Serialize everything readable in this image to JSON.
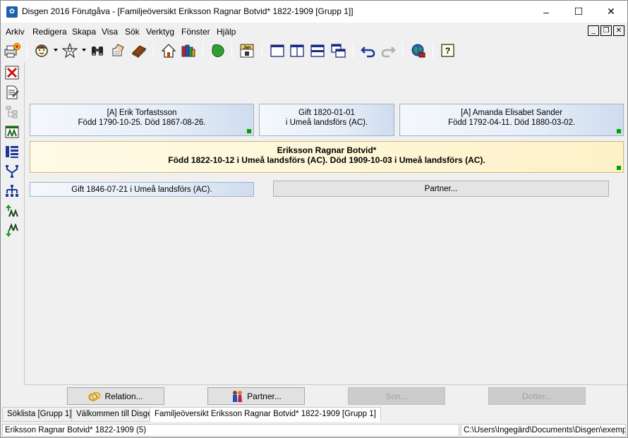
{
  "window": {
    "title": "Disgen 2016 Förutgåva - [Familjeöversikt Eriksson Ragnar Botvid* 1822-1909 [Grupp 1]]",
    "minimize": "–",
    "maximize": "☐",
    "close": "✕"
  },
  "menu": [
    "Arkiv",
    "Redigera",
    "Skapa",
    "Visa",
    "Sök",
    "Verktyg",
    "Fönster",
    "Hjälp"
  ],
  "mdi": {
    "minimize": "_",
    "restore": "❐",
    "close": "✕"
  },
  "toolbar_icons": [
    "print-icon",
    "person-icon",
    "star-person-icon",
    "binoculars-icon",
    "hand-icon",
    "book-icon",
    "home-icon",
    "books-icon",
    "map-icon",
    "calendar-icon",
    "window-single-icon",
    "window-split-icon",
    "window-horizontal-icon",
    "window-cascade-icon",
    "undo-icon",
    "redo-icon",
    "globe-icon",
    "help-icon"
  ],
  "calendar_label": "Jan",
  "help_label": "?",
  "family": {
    "father": {
      "name": "[A] Erik Torfastsson",
      "dates": "Född 1790-10-25. Död 1867-08-26."
    },
    "parents_marriage": {
      "line1": "Gift 1820-01-01",
      "line2": "i  Umeå landsförs (AC)."
    },
    "mother": {
      "name": "[A] Amanda Elisabet Sander",
      "dates": "Född 1792-04-11. Död 1880-03-02."
    },
    "person": {
      "name": "Eriksson Ragnar Botvid*",
      "details": "Född 1822-10-12 i Umeå landsförs (AC). Död 1909-10-03 i Umeå landsförs (AC)."
    },
    "marriage": "Gift 1846-07-21 i Umeå landsförs (AC).",
    "partner_button": "Partner..."
  },
  "bottom_buttons": {
    "relation": "Relation...",
    "partner": "Partner...",
    "son": "Son...",
    "daughter": "Dotter..."
  },
  "tabs": [
    "Söklista [Grupp 1]",
    "Välkommen till Disgen",
    "Familjeöversikt Eriksson Ragnar Botvid* 1822-1909 [Grupp 1]"
  ],
  "status": {
    "left": "Eriksson Ragnar Botvid* 1822-1909 (5)",
    "right": "C:\\Users\\Ingegärd\\Documents\\Disgen\\exempel"
  },
  "colors": {
    "accent_blue": "#1f5fb0",
    "person_highlight": "#fdf1c8",
    "dot_green": "#00a000"
  }
}
